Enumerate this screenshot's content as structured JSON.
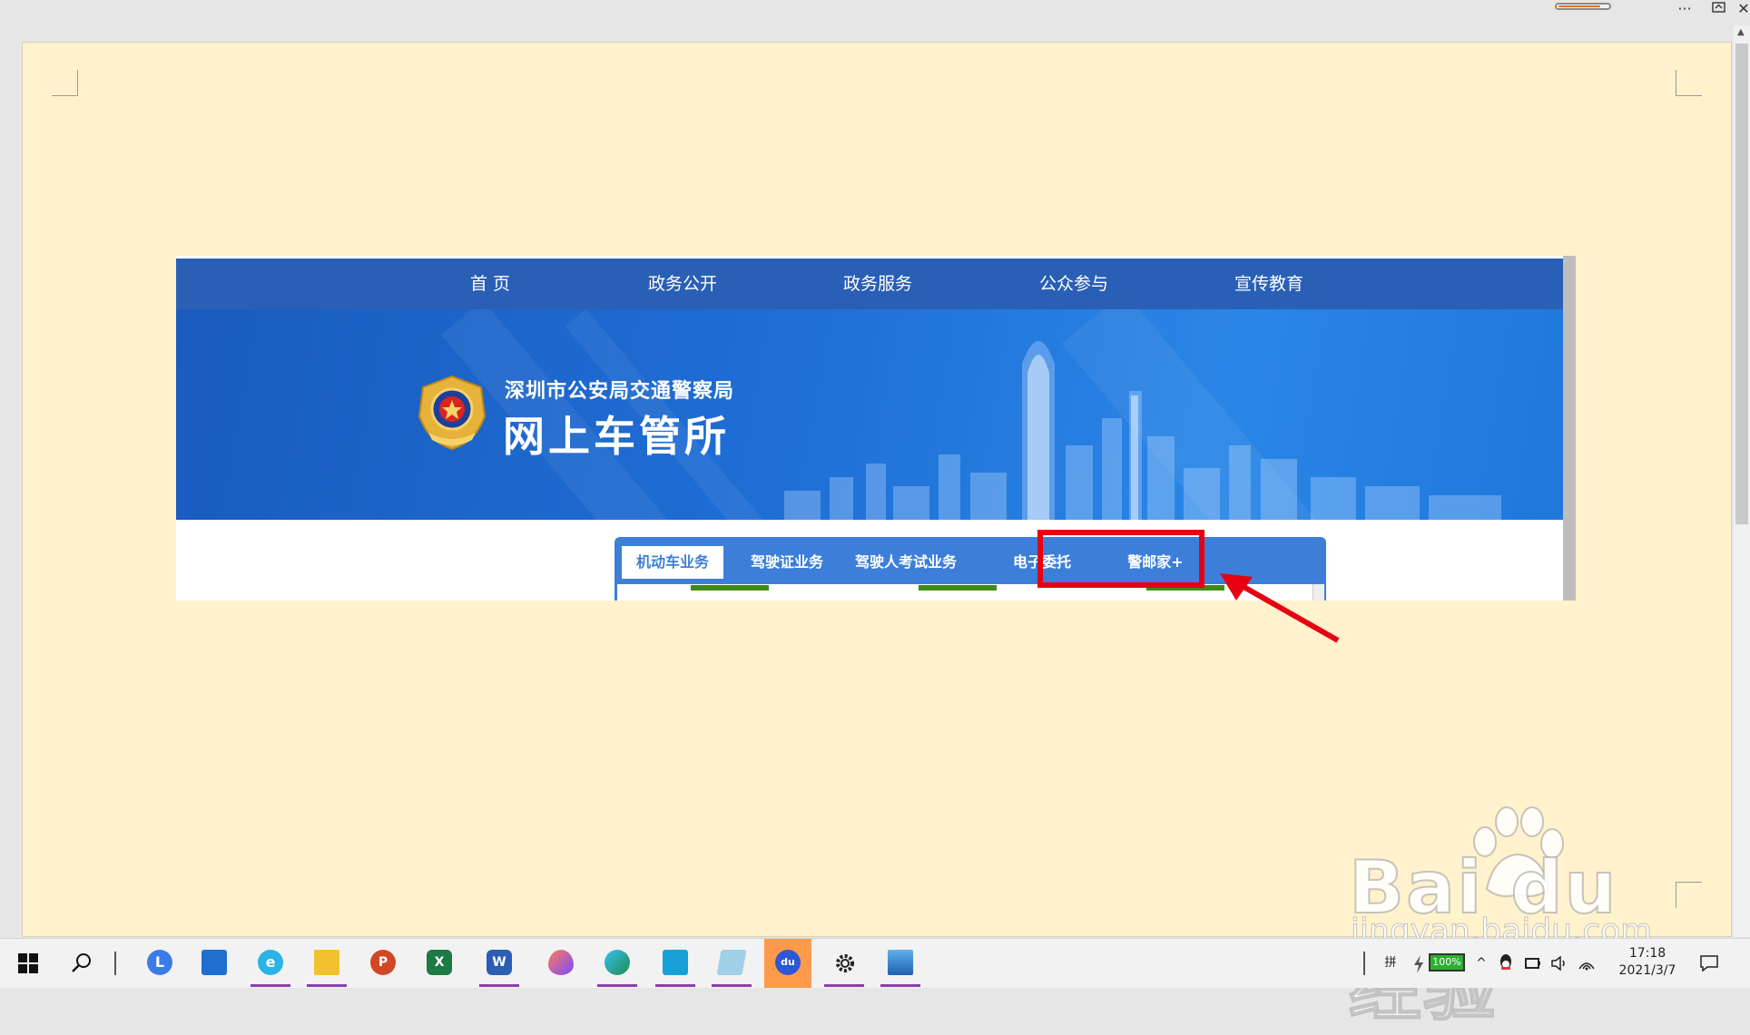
{
  "window": {
    "more_label": "···",
    "restore_icon": "restore-icon",
    "close_label": "✕",
    "ribbon_progress": 0.85
  },
  "site": {
    "nav": [
      "首 页",
      "政务公开",
      "政务服务",
      "公众参与",
      "宣传教育"
    ],
    "org_name": "深圳市公安局交通警察局",
    "title": "网上车管所",
    "tabs": [
      {
        "label": "机动车业务",
        "active": true
      },
      {
        "label": "驾驶证业务",
        "active": false
      },
      {
        "label": "驾驶人考试业务",
        "active": false
      },
      {
        "label": "电子委托",
        "active": false,
        "highlighted": true
      },
      {
        "label": "警邮家+",
        "active": false
      }
    ]
  },
  "annotation": {
    "color": "#e60012",
    "target": "电子委托"
  },
  "watermark": {
    "brand": "Bai du经验",
    "url": "jingyan.baidu.com"
  },
  "taskbar": {
    "apps": [
      "start-icon",
      "search-icon",
      "app-l-icon",
      "mail-icon",
      "ie-icon",
      "file-explorer-icon",
      "powerpoint-icon",
      "excel-icon",
      "word-icon",
      "paint-drop-icon",
      "edge-icon",
      "tablet-app-icon",
      "notes-app-icon",
      "baidu-icon",
      "settings-icon",
      "photos-icon"
    ],
    "ime_label": "拼",
    "battery_label": "100%",
    "time": "17:18",
    "date": "2021/3/7"
  }
}
